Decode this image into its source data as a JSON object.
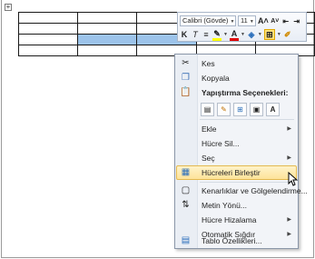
{
  "mini_toolbar": {
    "font_name": "Calibri (Gövde)",
    "font_size": "11",
    "grow_font": "A˄",
    "shrink_font": "A˅",
    "bold": "K",
    "italic": "T",
    "center": "≡",
    "font_color": "A"
  },
  "context_menu": {
    "cut": "Kes",
    "copy": "Kopyala",
    "paste_options_header": "Yapıştırma Seçenekleri:",
    "insert": "Ekle",
    "delete_cells": "Hücre Sil...",
    "select": "Seç",
    "merge_cells": "Hücreleri Birleştir",
    "borders_shading": "Kenarlıklar ve Gölgelendirme...",
    "text_direction": "Metin Yönü...",
    "cell_alignment": "Hücre Hizalama",
    "autofit": "Otomatik Sığdır",
    "table_properties": "Tablo Özellikleri..."
  },
  "colors": {
    "selected_cell": "#9cc3ea",
    "highlight": "#fde39a"
  }
}
